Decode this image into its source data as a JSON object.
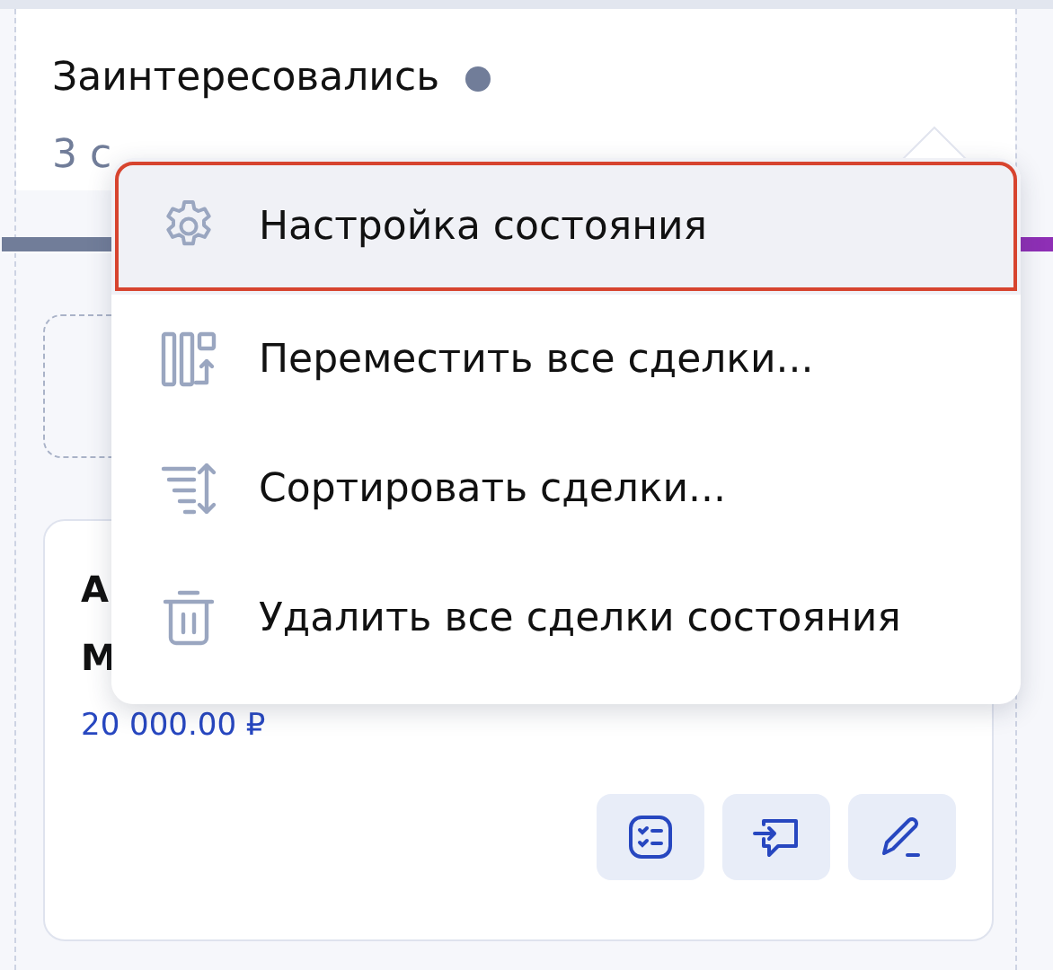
{
  "column": {
    "title": "Заинтересовались",
    "count_text": "3 с"
  },
  "card": {
    "line_1": "А",
    "line_2": "М",
    "amount": "20 000.00 ₽",
    "actions": [
      {
        "kind": "tasks"
      },
      {
        "kind": "comment"
      },
      {
        "kind": "edit"
      }
    ]
  },
  "menu": {
    "items": [
      {
        "kind": "settings",
        "label": "Настройка состояния",
        "selected": true
      },
      {
        "kind": "move",
        "label": "Переместить все сделки...",
        "selected": false
      },
      {
        "kind": "sort",
        "label": "Сортировать сделки...",
        "selected": false
      },
      {
        "kind": "delete",
        "label": "Удалить все сделки состояния",
        "selected": false
      }
    ]
  }
}
